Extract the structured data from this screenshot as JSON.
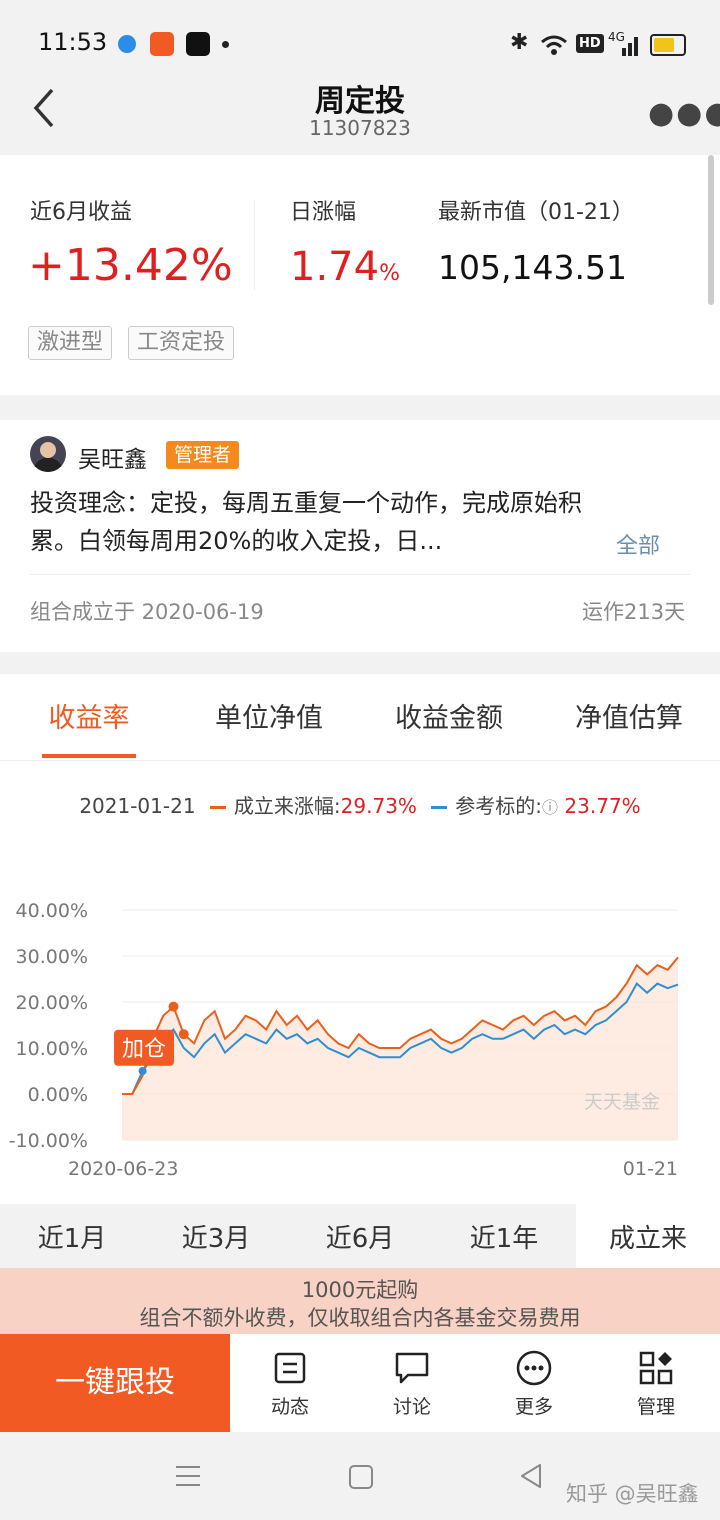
{
  "status": {
    "time": "11:53",
    "hd": "HD",
    "net": "4G"
  },
  "header": {
    "title": "周定投",
    "subtitle": "11307823",
    "back_icon": "chevron-left-icon",
    "more_icon": "more-dots-icon"
  },
  "summary": {
    "return_label": "近6月收益",
    "return_value": "+13.42%",
    "daily_label": "日涨幅",
    "daily_value": "1.74",
    "daily_unit": "%",
    "market_label": "最新市值（01-21）",
    "market_value": "105,143.51",
    "tags": [
      "激进型",
      "工资定投"
    ]
  },
  "manager": {
    "name": "吴旺鑫",
    "badge": "管理者",
    "description": "投资理念：定投，每周五重复一个动作，完成原始积累。白领每周用20%的收入定投，日...",
    "desc_line1": "投资理念：定投，每周五重复一个动作，完成原始积",
    "desc_line2": "累。白领每周用20%的收入定投，日...",
    "all_label": "全部",
    "founded": "组合成立于 2020-06-19",
    "running": "运作213天"
  },
  "tabs": [
    "收益率",
    "单位净值",
    "收益金额",
    "净值估算"
  ],
  "active_tab": 0,
  "legend": {
    "date": "2021-01-21",
    "series1_label": "成立来涨幅:",
    "series1_value": "29.73%",
    "series2_label": "参考标的:",
    "series2_value": "23.77%"
  },
  "colors": {
    "accent": "#f15a22",
    "red": "#e02020",
    "blue": "#2f8fd0",
    "orange_line": "#e8601c"
  },
  "chart_data": {
    "type": "line",
    "x_start_label": "2020-06-23",
    "x_end_label": "01-21",
    "y_ticks": [
      "40.00%",
      "30.00%",
      "20.00%",
      "10.00%",
      "0.00%",
      "-10.00%"
    ],
    "ylim": [
      -10,
      40
    ],
    "annotation": "加仓",
    "watermark": "天天基金",
    "series": [
      {
        "name": "成立来涨幅",
        "color": "#e8601c",
        "values": [
          0,
          0,
          4,
          12,
          17,
          19,
          13,
          11,
          16,
          18,
          12,
          14,
          17,
          16,
          14,
          18,
          15,
          17,
          14,
          16,
          13,
          11,
          10,
          13,
          11,
          10,
          10,
          10,
          12,
          13,
          14,
          12,
          11,
          12,
          14,
          16,
          15,
          14,
          16,
          17,
          15,
          17,
          18,
          16,
          17,
          15,
          18,
          19,
          21,
          24,
          28,
          26,
          28,
          27,
          29.7
        ]
      },
      {
        "name": "参考标的",
        "color": "#2f8fd0",
        "values": [
          0,
          0,
          5,
          8,
          12,
          14,
          10,
          8,
          11,
          13,
          9,
          11,
          13,
          12,
          11,
          14,
          12,
          13,
          11,
          12,
          10,
          9,
          8,
          10,
          9,
          8,
          8,
          8,
          10,
          11,
          12,
          10,
          9,
          10,
          12,
          13,
          12,
          12,
          13,
          14,
          12,
          14,
          15,
          13,
          14,
          13,
          15,
          16,
          18,
          20,
          24,
          22,
          24,
          23,
          23.8
        ]
      }
    ]
  },
  "periods": [
    "近1月",
    "近3月",
    "近6月",
    "近1年",
    "成立来"
  ],
  "active_period": 4,
  "notice": {
    "line1": "1000元起购",
    "line2": "组合不额外收费，仅收取组合内各基金交易费用"
  },
  "actions": {
    "follow": "一键跟投",
    "items": [
      {
        "label": "动态",
        "icon": "news-icon"
      },
      {
        "label": "讨论",
        "icon": "chat-icon"
      },
      {
        "label": "更多",
        "icon": "more-circle-icon"
      },
      {
        "label": "管理",
        "icon": "grid-icon"
      }
    ]
  },
  "watermark": "知乎 @吴旺鑫"
}
